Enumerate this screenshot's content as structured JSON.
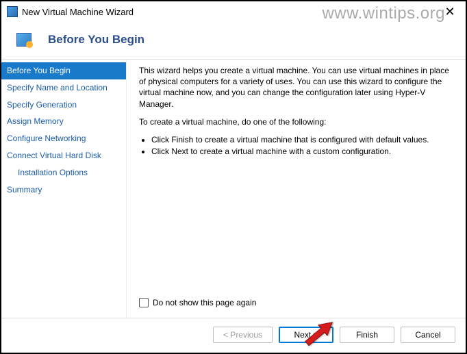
{
  "title_bar": {
    "title": "New Virtual Machine Wizard"
  },
  "watermark": "www.wintips.org",
  "header": {
    "title": "Before You Begin"
  },
  "sidebar": {
    "items": [
      {
        "label": "Before You Begin",
        "active": true
      },
      {
        "label": "Specify Name and Location",
        "active": false
      },
      {
        "label": "Specify Generation",
        "active": false
      },
      {
        "label": "Assign Memory",
        "active": false
      },
      {
        "label": "Configure Networking",
        "active": false
      },
      {
        "label": "Connect Virtual Hard Disk",
        "active": false
      },
      {
        "label": "Installation Options",
        "active": false,
        "sub": true
      },
      {
        "label": "Summary",
        "active": false
      }
    ]
  },
  "main": {
    "para1": "This wizard helps you create a virtual machine. You can use virtual machines in place of physical computers for a variety of uses. You can use this wizard to configure the virtual machine now, and you can change the configuration later using Hyper-V Manager.",
    "para2": "To create a virtual machine, do one of the following:",
    "bullets": [
      "Click Finish to create a virtual machine that is configured with default values.",
      "Click Next to create a virtual machine with a custom configuration."
    ],
    "checkbox_label": "Do not show this page again"
  },
  "buttons": {
    "previous": "< Previous",
    "next": "Next >",
    "finish": "Finish",
    "cancel": "Cancel"
  }
}
